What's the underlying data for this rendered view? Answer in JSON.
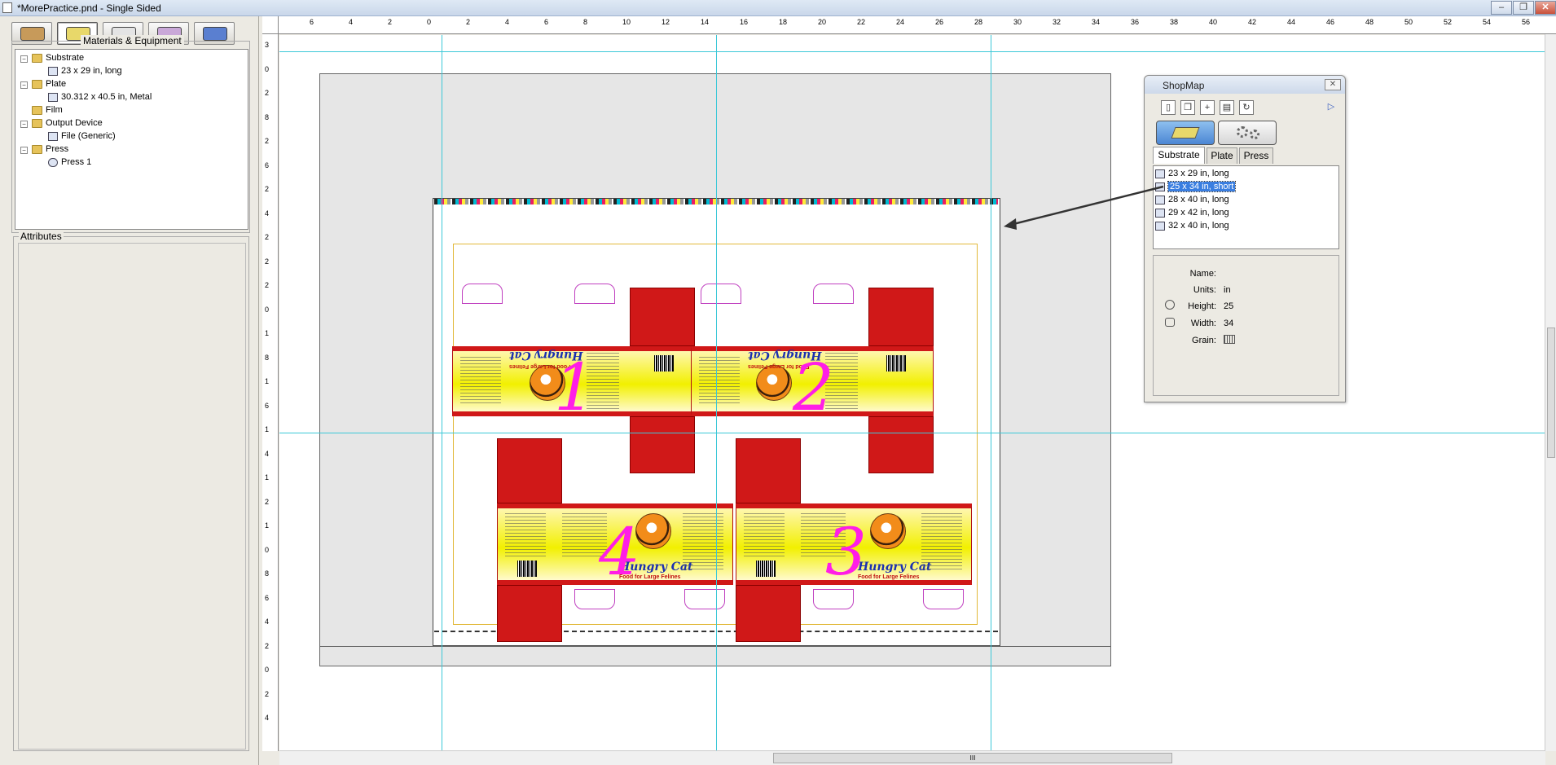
{
  "window": {
    "title": "*MorePractice.pnd - Single Sided",
    "controls": [
      "–",
      "❐",
      "✕"
    ]
  },
  "left_panel": {
    "tab_icons": [
      "job-info-icon",
      "materials-icon",
      "layout-icon",
      "output-icon",
      "info-icon"
    ],
    "materials_title": "Materials & Equipment",
    "tree": [
      {
        "label": "Substrate",
        "type": "folder",
        "level": 0
      },
      {
        "label": "23 x 29 in, long",
        "type": "doc",
        "level": 1
      },
      {
        "label": "Plate",
        "type": "folder",
        "level": 0
      },
      {
        "label": "30.312 x 40.5 in, Metal",
        "type": "doc",
        "level": 1
      },
      {
        "label": "Film",
        "type": "folder",
        "level": 0
      },
      {
        "label": "Output Device",
        "type": "folder",
        "level": 0
      },
      {
        "label": "File (Generic)",
        "type": "doc",
        "level": 1
      },
      {
        "label": "Press",
        "type": "folder",
        "level": 0
      },
      {
        "label": "Press 1",
        "type": "press",
        "level": 1
      }
    ],
    "attributes_title": "Attributes"
  },
  "rulers": {
    "horizontal": [
      "6",
      "4",
      "2",
      "0",
      "2",
      "4",
      "6",
      "8",
      "10",
      "12",
      "14",
      "16",
      "18",
      "20",
      "22",
      "24",
      "26",
      "28",
      "30",
      "32",
      "34",
      "36",
      "38",
      "40",
      "42",
      "44",
      "46",
      "48",
      "50",
      "52",
      "54",
      "56"
    ],
    "vertical": [
      "3",
      "0",
      "2",
      "8",
      "2",
      "6",
      "2",
      "4",
      "2",
      "2",
      "2",
      "0",
      "1",
      "8",
      "1",
      "6",
      "1",
      "4",
      "1",
      "2",
      "1",
      "0",
      "8",
      "6",
      "4",
      "2",
      "0",
      "2",
      "4"
    ]
  },
  "canvas": {
    "cartons": [
      {
        "number": "1",
        "brand": "Hungry Cat",
        "tagline": "Food for Large Felines"
      },
      {
        "number": "2",
        "brand": "Hungry Cat",
        "tagline": "Food for Large Felines"
      },
      {
        "number": "4",
        "brand": "Hungry Cat",
        "tagline": "Food for Large Felines"
      },
      {
        "number": "3",
        "brand": "Hungry Cat",
        "tagline": "Food for Large Felines"
      }
    ]
  },
  "shopmap": {
    "title": "ShopMap",
    "close": "✕",
    "toolbar": [
      "new-icon",
      "copy-icon",
      "add-icon",
      "delete-icon",
      "refresh-icon"
    ],
    "play": "▷",
    "tabs": [
      "Substrate",
      "Plate",
      "Press"
    ],
    "active_tab": "Substrate",
    "items": [
      "23 x 29 in, long",
      "25 x 34 in, short",
      "28 x 40 in, long",
      "29 x 42 in, long",
      "32 x 40 in, long"
    ],
    "selected_item": "25 x 34 in, short",
    "properties": {
      "name_label": "Name:",
      "name_value": "",
      "units_label": "Units:",
      "units_value": "in",
      "height_label": "Height:",
      "height_value": "25",
      "width_label": "Width:",
      "width_value": "34",
      "grain_label": "Grain:"
    }
  },
  "scrollbar": {
    "grip": "III"
  },
  "colors": {
    "guide": "#3cc8d8",
    "carton_red": "#d01818",
    "carton_yellow": "#f2f000",
    "number_magenta": "#ff1ee6",
    "selection": "#3a7ee0"
  }
}
